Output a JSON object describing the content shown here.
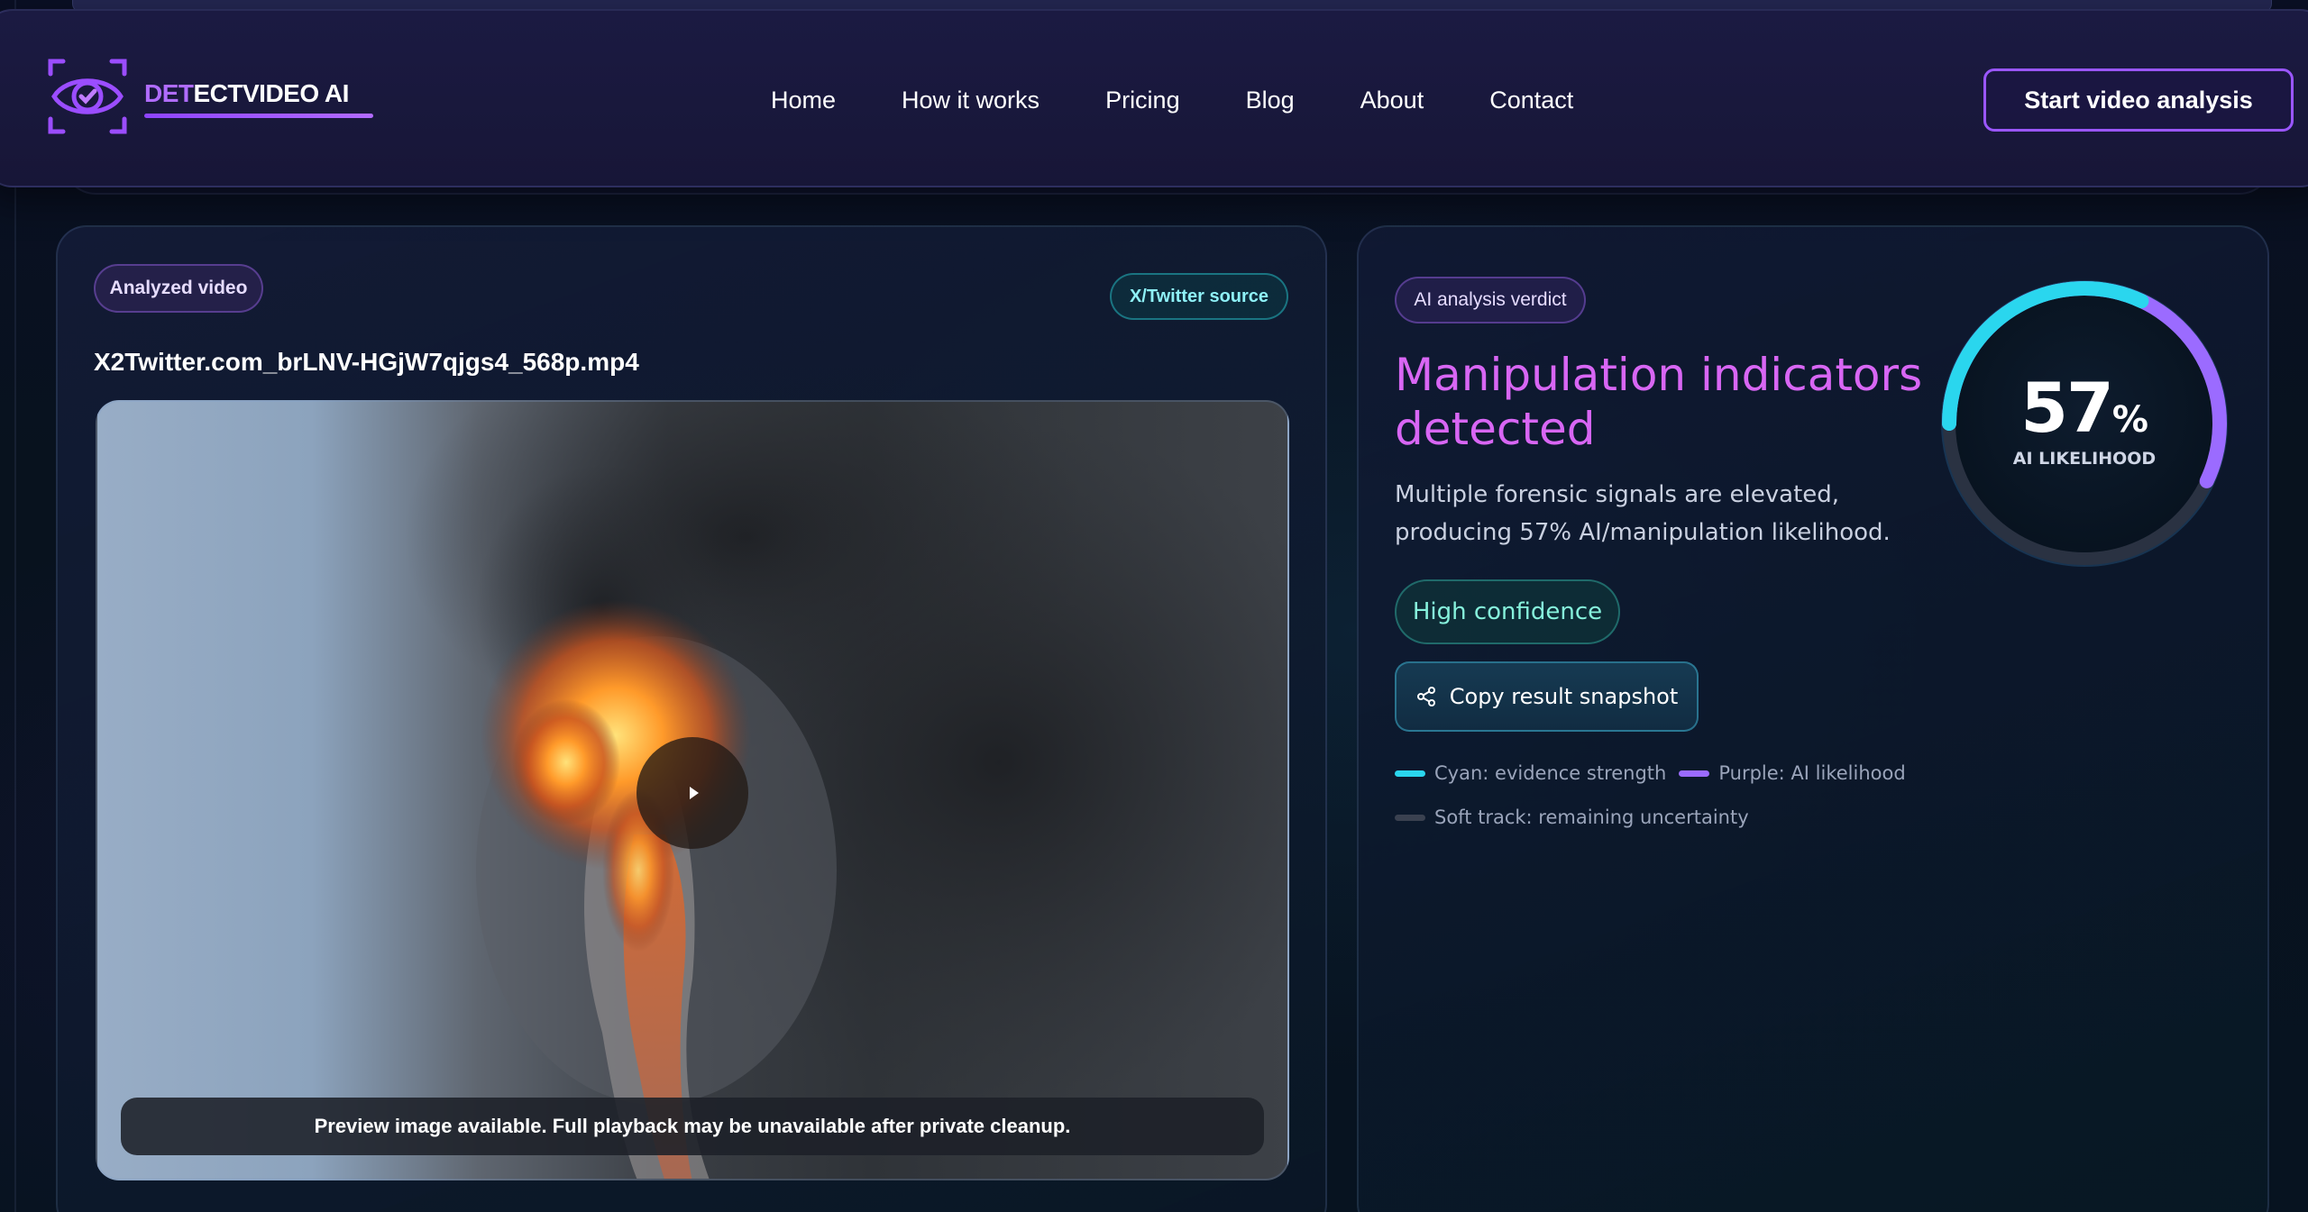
{
  "brand": {
    "part1": "DET",
    "part2": "ECTVIDEO AI"
  },
  "nav": {
    "items": [
      "Home",
      "How it works",
      "Pricing",
      "Blog",
      "About",
      "Contact"
    ]
  },
  "header": {
    "cta_label": "Start video analysis"
  },
  "video_card": {
    "badge": "Analyzed video",
    "source_badge": "X/Twitter source",
    "filename": "X2Twitter.com_brLNV-HGjW7qjgs4_568p.mp4",
    "caption": "Preview image available. Full playback may be unavailable after private cleanup."
  },
  "verdict_card": {
    "badge": "AI analysis verdict",
    "headline": "Manipulation indicators detected",
    "description": "Multiple forensic signals are elevated, producing 57% AI/manipulation likelihood.",
    "confidence": "High confidence",
    "copy_label": "Copy result snapshot",
    "gauge": {
      "value": "57",
      "unit": "%",
      "label": "AI LIKELIHOOD",
      "likelihood": 0.57
    },
    "legend": [
      {
        "label": "Cyan: evidence strength",
        "color": "#2ad6ee"
      },
      {
        "label": "Purple: AI likelihood",
        "color": "#9b6bff"
      },
      {
        "label": "Soft track: remaining uncertainty",
        "color": "#3a4150"
      }
    ]
  },
  "colors": {
    "accent_purple": "#9a56ff",
    "headline_pink": "#d866f4",
    "cyan": "#2ad6ee"
  }
}
